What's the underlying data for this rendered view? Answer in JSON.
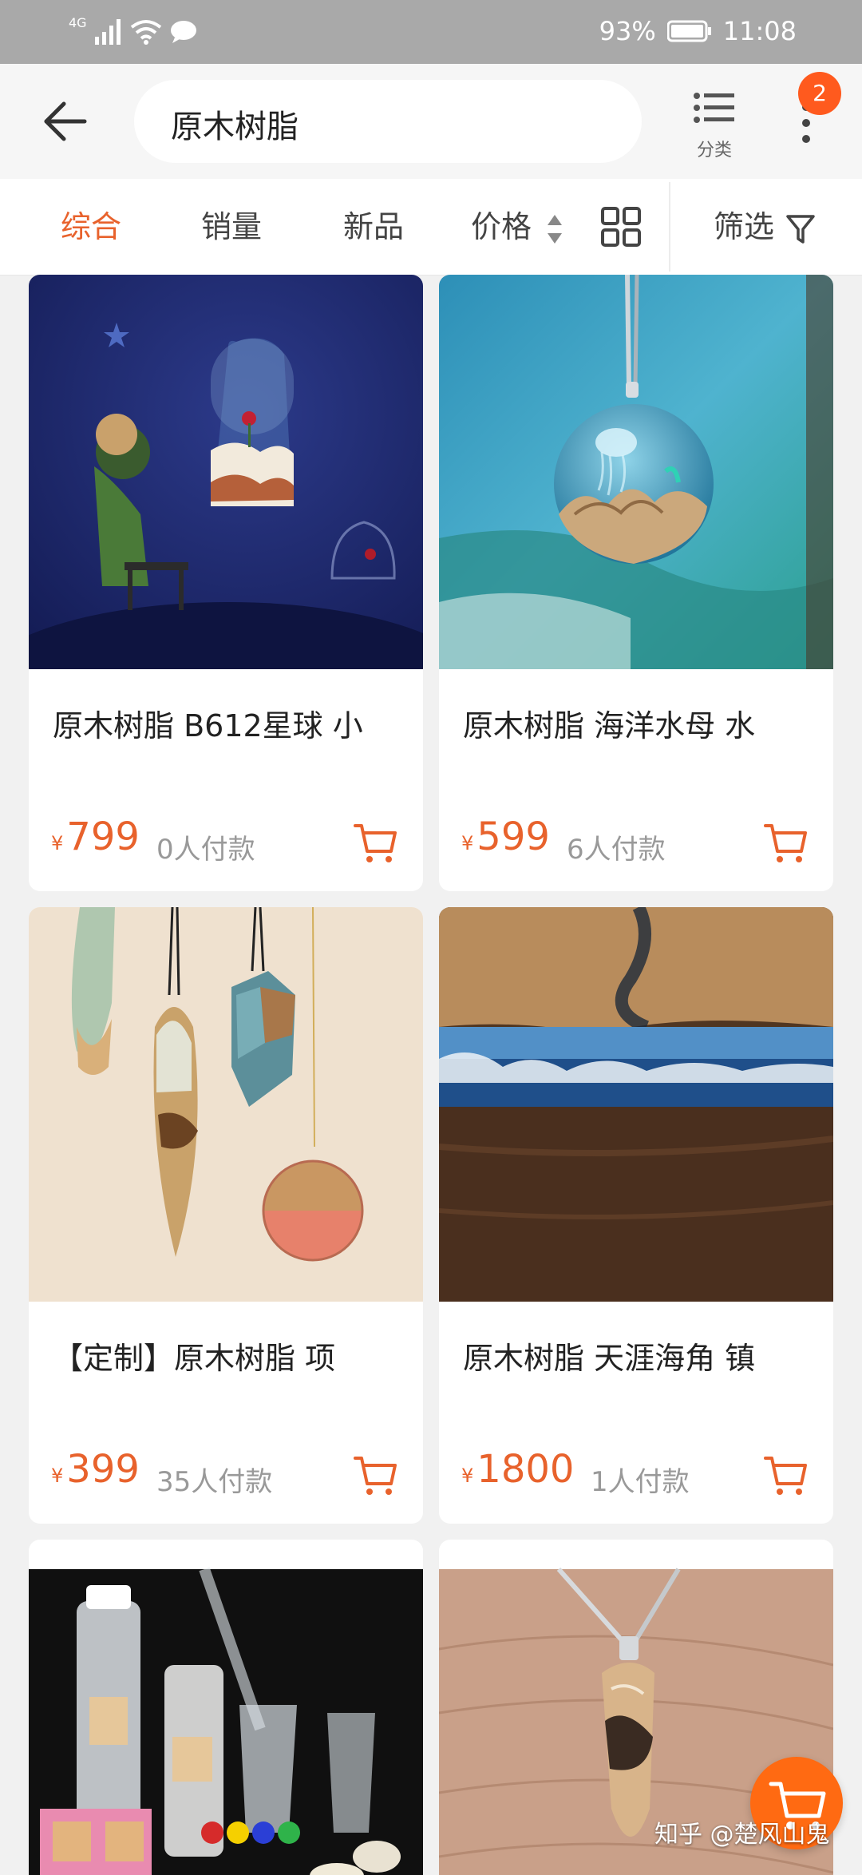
{
  "status_bar": {
    "network": "4G",
    "battery": "93%",
    "time": "11:08"
  },
  "header": {
    "search_query": "原木树脂",
    "category_label": "分类",
    "notification_count": "2"
  },
  "sort_tabs": [
    {
      "label": "综合",
      "active": true
    },
    {
      "label": "销量",
      "active": false
    },
    {
      "label": "新品",
      "active": false
    },
    {
      "label": "价格",
      "active": false
    },
    {
      "label": "筛选",
      "active": false
    }
  ],
  "currency_symbol": "¥",
  "products": [
    {
      "title": "原木树脂 B612星球  小",
      "price": "799",
      "sold": "0人付款"
    },
    {
      "title": "原木树脂 海洋水母 水",
      "price": "599",
      "sold": "6人付款"
    },
    {
      "title": "【定制】原木树脂 项",
      "price": "399",
      "sold": "35人付款"
    },
    {
      "title": "原木树脂 天涯海角 镇",
      "price": "1800",
      "sold": "1人付款"
    }
  ],
  "watermark": "知乎 @楚风山鬼",
  "colors": {
    "accent": "#e8622c",
    "badge": "#ff5a1e",
    "status_bar": "#a9a9a9"
  }
}
